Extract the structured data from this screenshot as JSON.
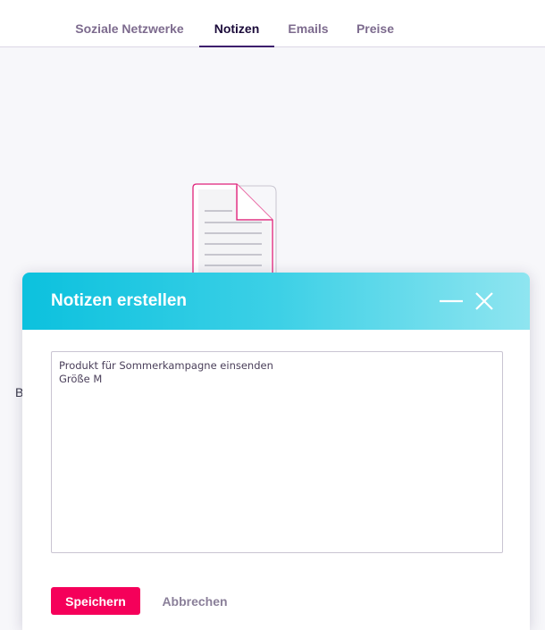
{
  "tabs": [
    {
      "label": "Soziale Netzwerke",
      "active": false
    },
    {
      "label": "Notizen",
      "active": true
    },
    {
      "label": "Emails",
      "active": false
    },
    {
      "label": "Preise",
      "active": false
    }
  ],
  "background": {
    "partial_text": "B"
  },
  "modal": {
    "title": "Notizen erstellen",
    "note_text": "Produkt für Sommerkampagne einsenden\nGröße M",
    "save_label": "Speichern",
    "cancel_label": "Abbrechen",
    "icons": {
      "minimize": "minimize-icon",
      "close": "close-icon"
    }
  },
  "colors": {
    "accent": "#f5005a",
    "header_gradient_start": "#0cc1de",
    "header_gradient_end": "#8fe5f0",
    "active_tab": "#1b0b3a",
    "illustration_stroke": "#e0227a"
  }
}
